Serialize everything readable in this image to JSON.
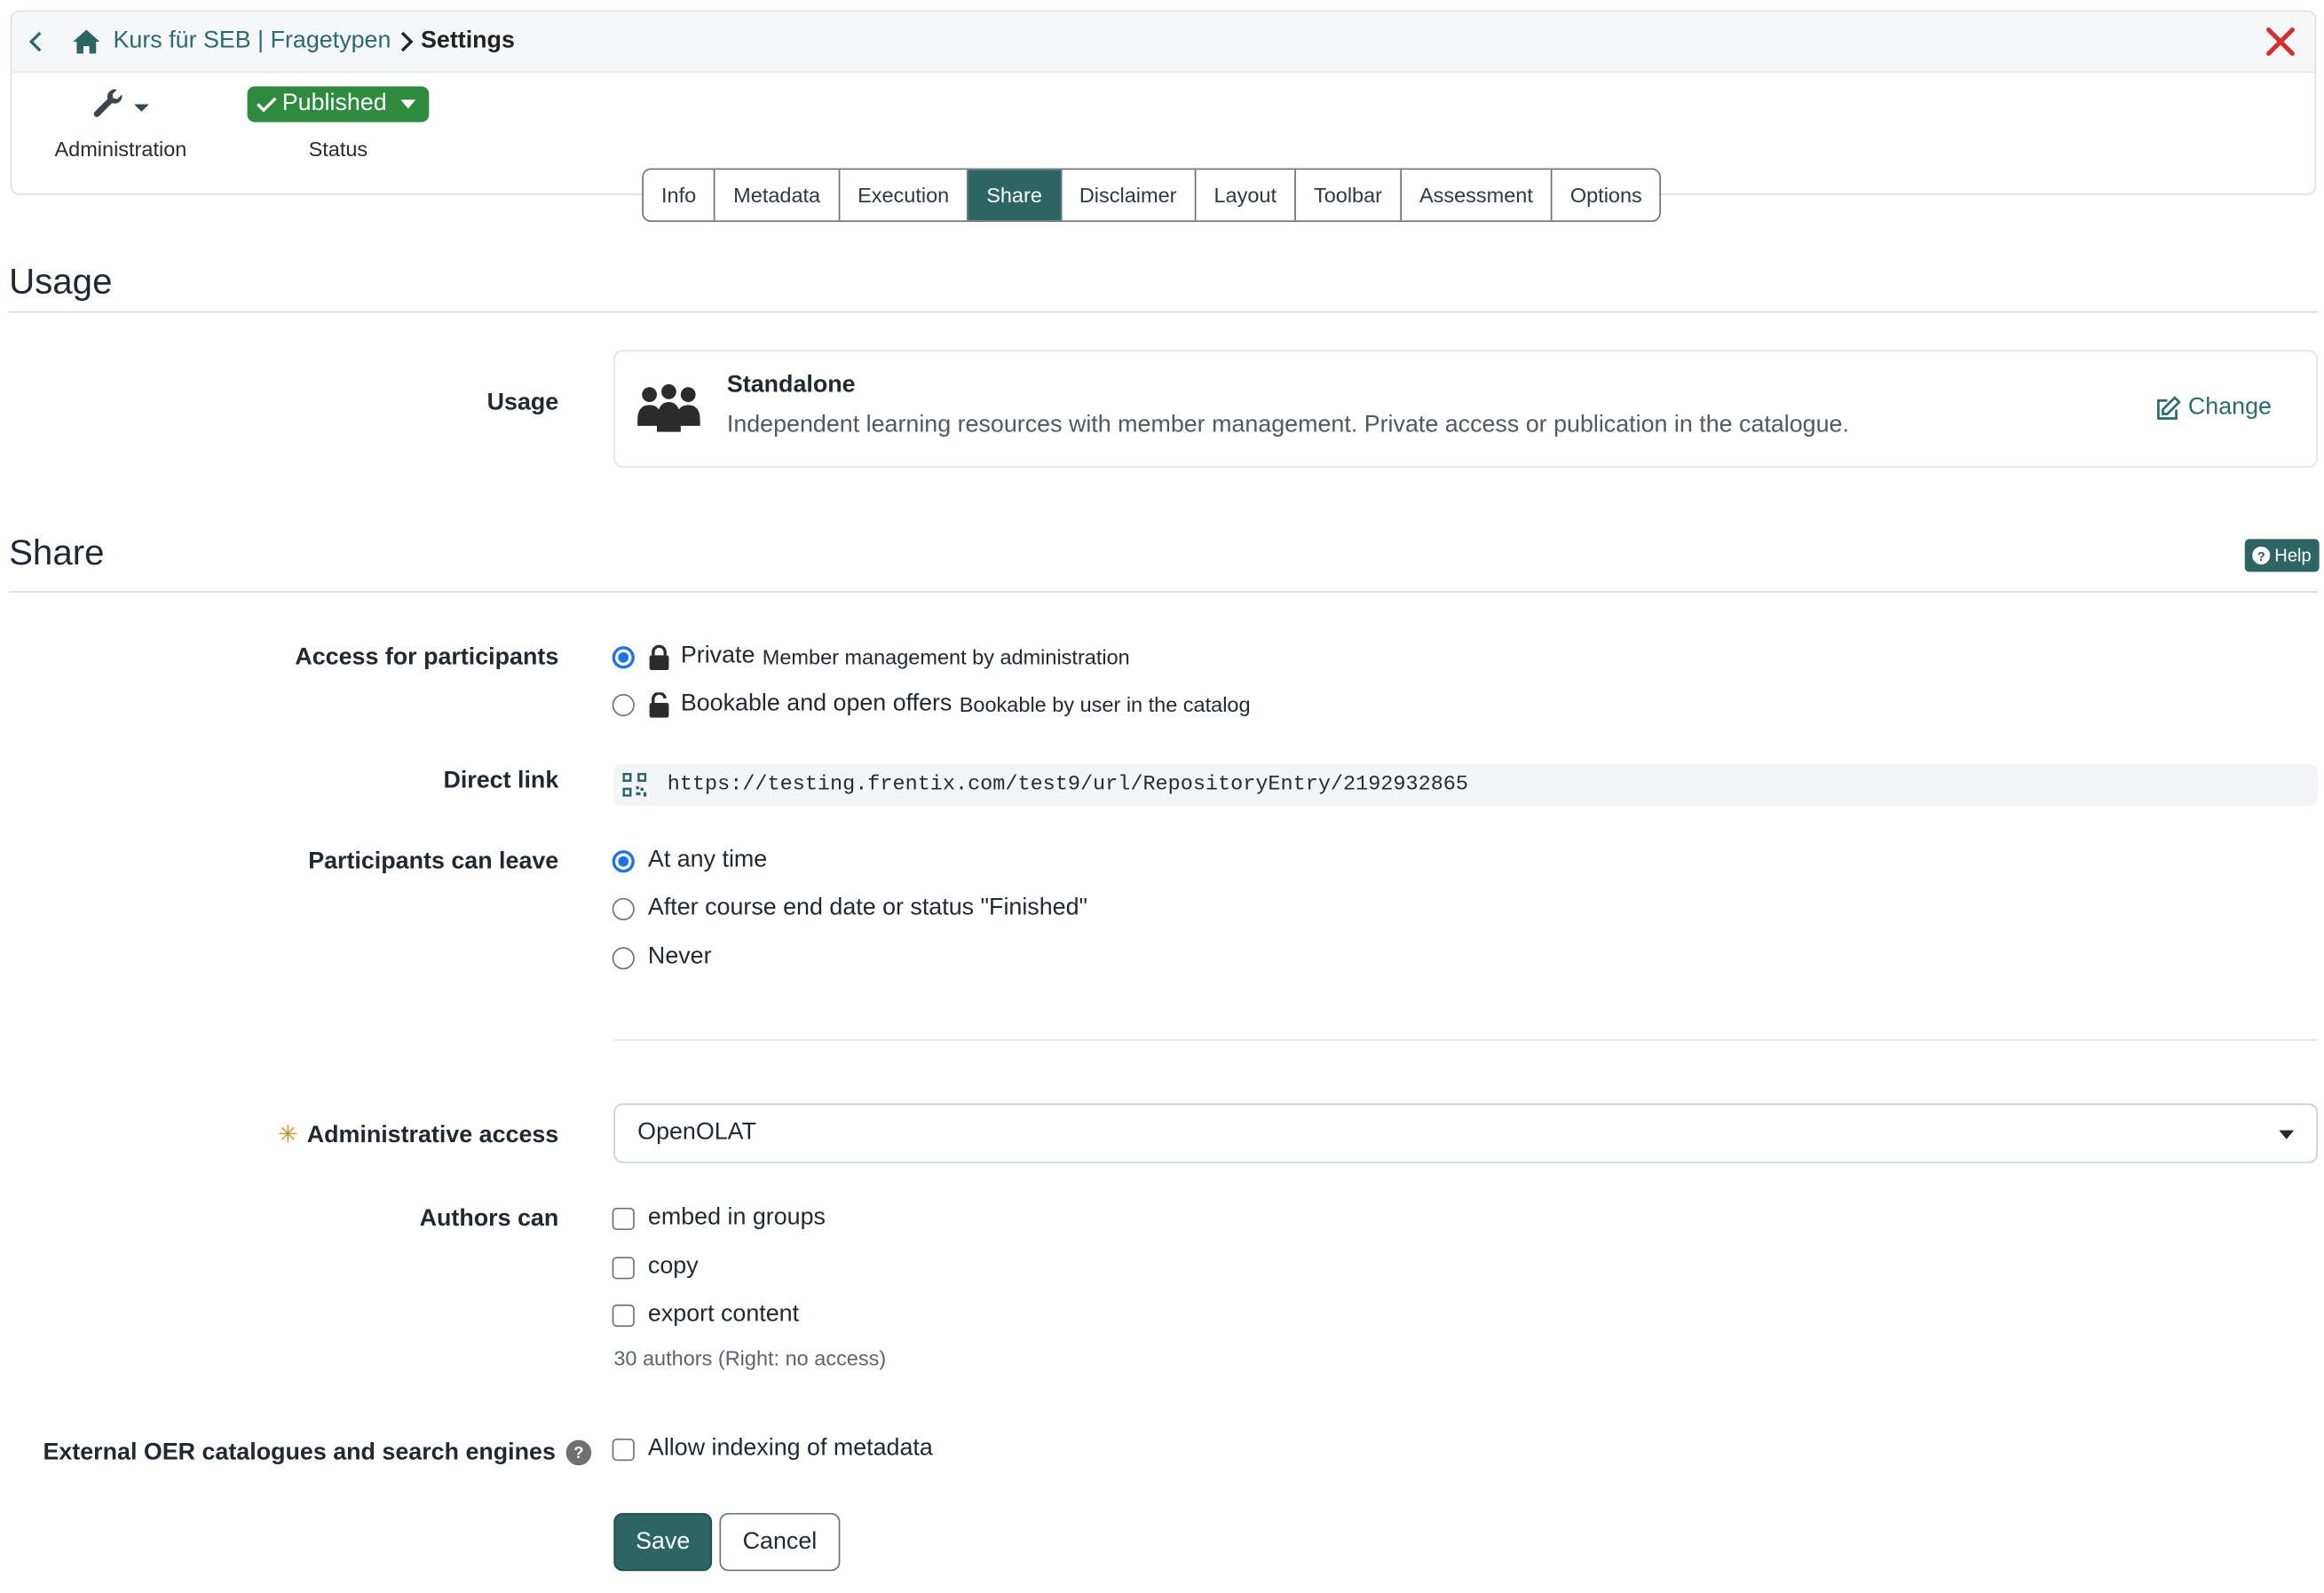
{
  "breadcrumb": {
    "course": "Kurs für SEB | Fragetypen",
    "current": "Settings"
  },
  "toolbar": {
    "admin_label": "Administration",
    "status_value": "Published",
    "status_label": "Status"
  },
  "tabs": [
    "Info",
    "Metadata",
    "Execution",
    "Share",
    "Disclaimer",
    "Layout",
    "Toolbar",
    "Assessment",
    "Options"
  ],
  "active_tab": "Share",
  "usage": {
    "section_title": "Usage",
    "label": "Usage",
    "type_title": "Standalone",
    "type_desc": "Independent learning resources with member management. Private access or publication in the catalogue.",
    "change_label": "Change"
  },
  "share": {
    "section_title": "Share",
    "help_label": "Help",
    "access_label": "Access for participants",
    "access_options": [
      {
        "label": "Private",
        "sub": "Member management by administration",
        "selected": true
      },
      {
        "label": "Bookable and open offers",
        "sub": "Bookable by user in the catalog",
        "selected": false
      }
    ],
    "direct_link_label": "Direct link",
    "direct_link_url": "https://testing.frentix.com/test9/url/RepositoryEntry/2192932865",
    "leave_label": "Participants can leave",
    "leave_options": [
      {
        "label": "At any time",
        "selected": true
      },
      {
        "label": "After course end date or status \"Finished\"",
        "selected": false
      },
      {
        "label": "Never",
        "selected": false
      }
    ],
    "admin_access_label": "Administrative access",
    "admin_access_value": "OpenOLAT",
    "authors_label": "Authors can",
    "authors_options": [
      {
        "label": "embed in groups",
        "checked": false
      },
      {
        "label": "copy",
        "checked": false
      },
      {
        "label": "export content",
        "checked": false
      }
    ],
    "authors_hint": "30 authors (Right: no access)",
    "oer_label": "External OER catalogues and search engines",
    "oer_option": "Allow indexing of metadata",
    "save_label": "Save",
    "cancel_label": "Cancel"
  },
  "colors": {
    "accent": "#2d6464",
    "link": "#2a6b6b",
    "status_green": "#2e8b3e",
    "close_red": "#d32f2f",
    "radio_blue": "#1a73e8",
    "required_star": "#d08a18"
  }
}
